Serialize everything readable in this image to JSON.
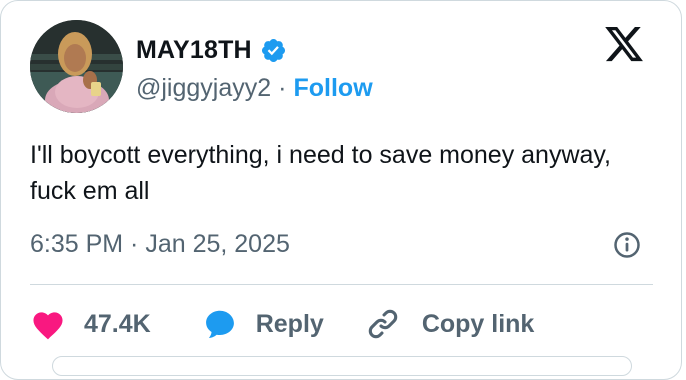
{
  "tweet": {
    "author": {
      "display_name": "MAY18TH",
      "handle": "@jiggyjayy2",
      "verified": true,
      "verified_icon": "verified-badge-icon",
      "avatar": "profile-photo"
    },
    "separator": "·",
    "follow_label": "Follow",
    "text": "I'll boycott everything, i need to save money anyway, fuck em all",
    "timestamp": "6:35 PM · Jan 25, 2025",
    "actions": {
      "like_count": "47.4K",
      "reply_label": "Reply",
      "copy_link_label": "Copy link"
    },
    "icons": {
      "platform_logo": "x-logo-icon",
      "info": "info-icon",
      "like": "heart-icon",
      "reply": "speech-bubble-icon",
      "copy_link": "link-icon"
    }
  },
  "colors": {
    "text_primary": "#0f1419",
    "text_secondary": "#536471",
    "accent_blue": "#1d9bf0",
    "like_pink": "#f91880",
    "border": "#cfd9de"
  }
}
